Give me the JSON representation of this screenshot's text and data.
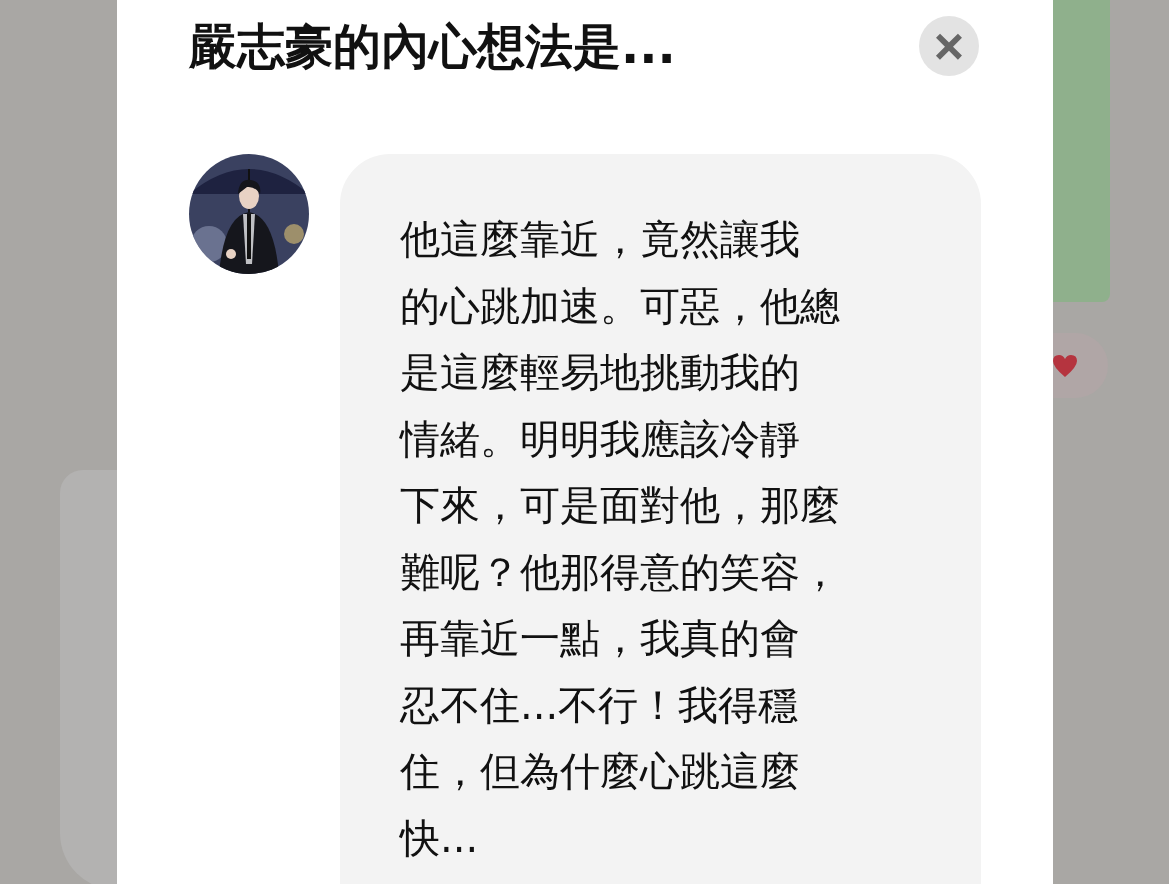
{
  "dialog": {
    "title": "嚴志豪的內心想法是...",
    "close_label": "×",
    "thought_lines": [
      "他這麼靠近，竟然讓我",
      "的心跳加速。可惡，他總",
      "是這麼輕易地挑動我的",
      "情緒。明明我應該冷靜",
      "下來，可是面對他，那麼",
      "難呢？他那得意的笑容，",
      "再靠近一點，我真的會",
      "忍不住...不行！我得穩",
      "住，但為什麼心跳這麼",
      "快..."
    ]
  },
  "background": {
    "liked": true
  }
}
